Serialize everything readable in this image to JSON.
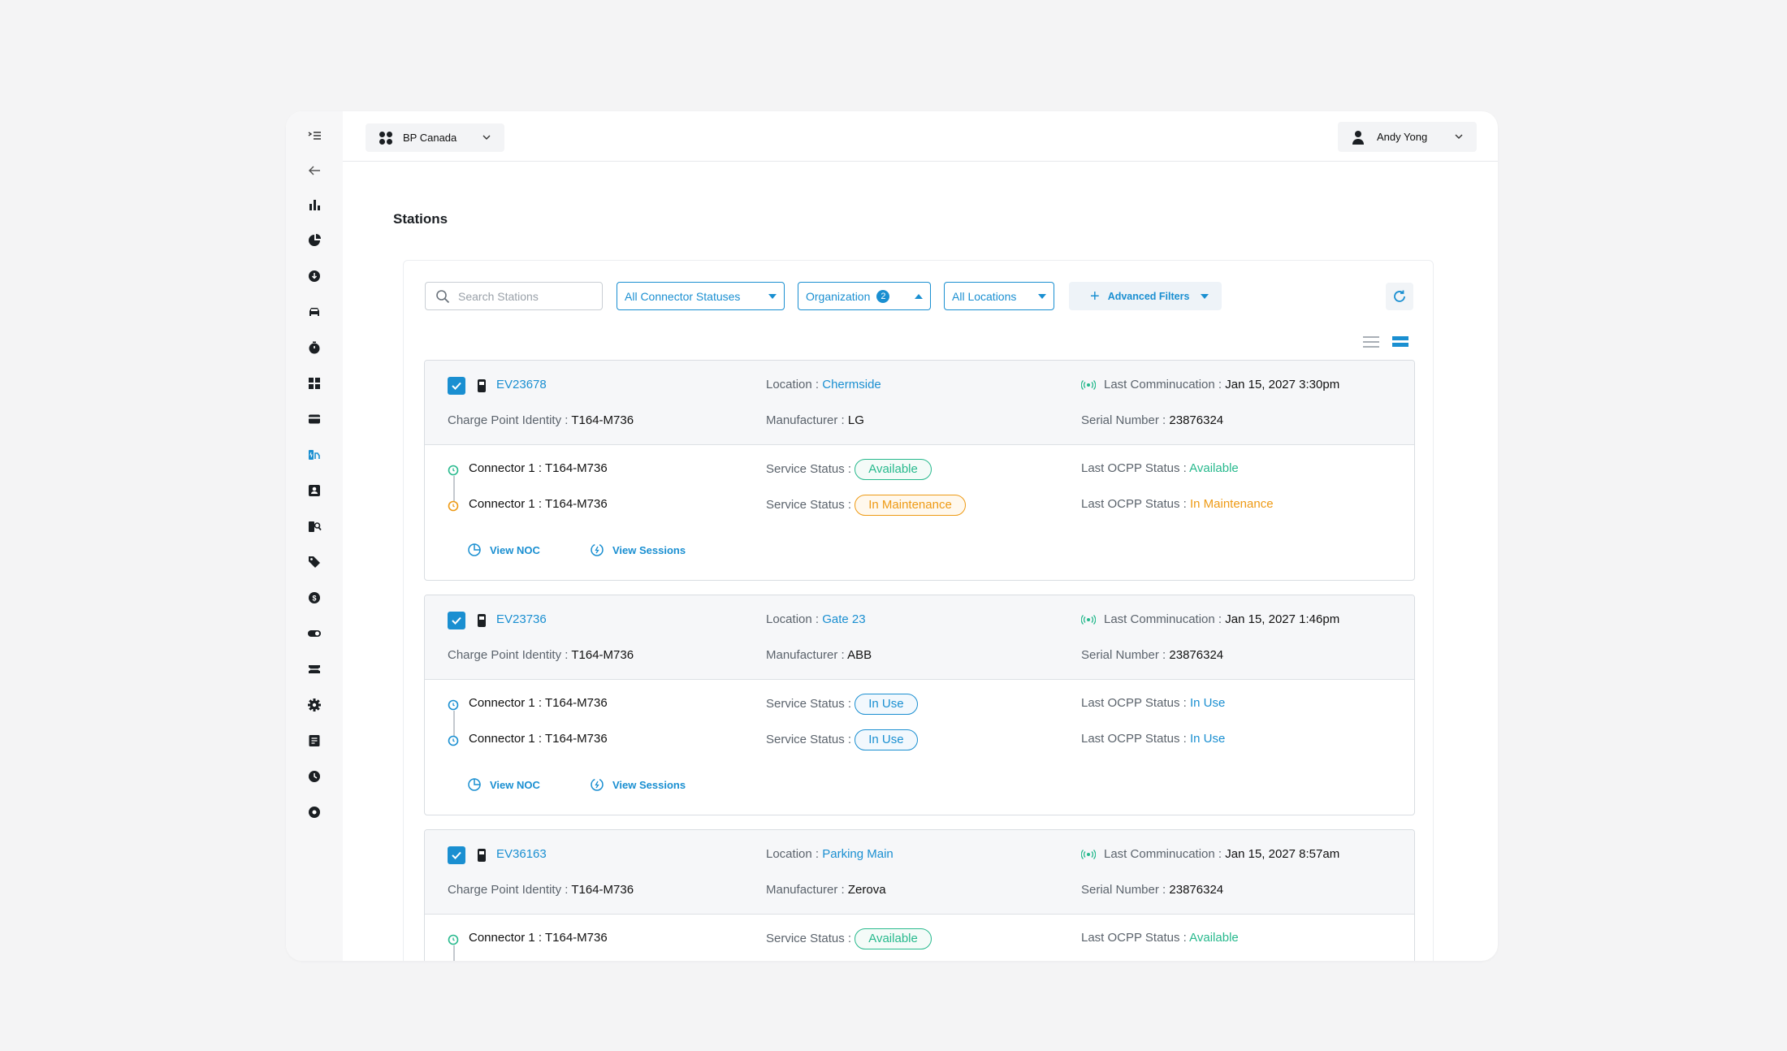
{
  "org_switcher": {
    "name": "BP Canada"
  },
  "user_menu": {
    "name": "Andy Yong"
  },
  "page": {
    "title": "Stations"
  },
  "filters": {
    "search_placeholder": "Search Stations",
    "connector_status": "All Connector Statuses",
    "organization": "Organization",
    "organization_count": "2",
    "locations": "All Locations",
    "advanced": "Advanced Filters"
  },
  "labels": {
    "charge_point_identity": "Charge Point Identity",
    "location": "Location",
    "manufacturer": "Manufacturer",
    "last_communication": "Last Comminucation",
    "serial_number": "Serial Number",
    "service_status": "Service Status",
    "last_ocpp_status": "Last OCPP Status",
    "view_noc": "View NOC",
    "view_sessions": "View Sessions",
    "colon": ":"
  },
  "colors": {
    "accent": "#1a8fd1",
    "available": "#27b98d",
    "maintenance": "#ee9a14",
    "in_use": "#1a8fd1"
  },
  "stations": [
    {
      "id": "EV23678",
      "charge_point_identity": "T164-M736",
      "location": "Chermside",
      "manufacturer": "LG",
      "last_communication": "Jan 15, 2027 3:30pm",
      "serial_number": "23876324",
      "connectors": [
        {
          "name": "Connector 1",
          "identity": "T164-M736",
          "service_status": "Available",
          "ocpp_status": "Available",
          "color": "green"
        },
        {
          "name": "Connector 1",
          "identity": "T164-M736",
          "service_status": "In Maintenance",
          "ocpp_status": "In Maintenance",
          "color": "orange"
        }
      ]
    },
    {
      "id": "EV23736",
      "charge_point_identity": "T164-M736",
      "location": "Gate 23",
      "manufacturer": "ABB",
      "last_communication": "Jan 15, 2027 1:46pm",
      "serial_number": "23876324",
      "connectors": [
        {
          "name": "Connector 1",
          "identity": "T164-M736",
          "service_status": "In Use",
          "ocpp_status": "In Use",
          "color": "blue"
        },
        {
          "name": "Connector 1",
          "identity": "T164-M736",
          "service_status": "In Use",
          "ocpp_status": "In Use",
          "color": "blue"
        }
      ]
    },
    {
      "id": "EV36163",
      "charge_point_identity": "T164-M736",
      "location": "Parking Main",
      "manufacturer": "Zerova",
      "last_communication": "Jan 15, 2027 8:57am",
      "serial_number": "23876324",
      "connectors": [
        {
          "name": "Connector 1",
          "identity": "T164-M736",
          "service_status": "Available",
          "ocpp_status": "Available",
          "color": "green"
        }
      ]
    }
  ],
  "sidebar_icons": [
    "collapse-menu-icon",
    "back-arrow-icon",
    "bar-chart-icon",
    "pie-chart-icon",
    "download-icon",
    "car-icon",
    "timer-icon",
    "dashboard-grid-icon",
    "payment-card-icon",
    "stations-icon",
    "contacts-icon",
    "fuel-search-icon",
    "tag-icon",
    "dollar-icon",
    "toggle-icon",
    "ticket-icon",
    "settings-gear-icon",
    "document-icon",
    "history-icon",
    "record-icon"
  ]
}
